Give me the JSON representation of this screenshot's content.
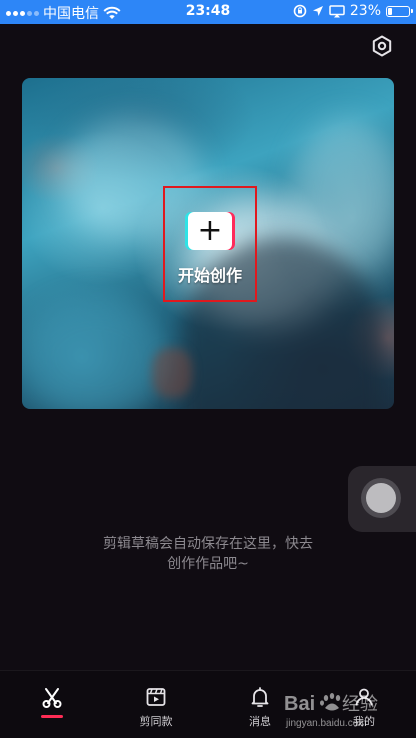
{
  "status_bar": {
    "carrier": "中国电信",
    "time": "23:48",
    "battery_percent": "23%",
    "battery_level": 0.23
  },
  "settings": {
    "icon": "hexagon-settings-icon"
  },
  "create": {
    "label": "开始创作",
    "icon_glyph": "+"
  },
  "hint": {
    "line1": "剪辑草稿会自动保存在这里，快去",
    "line2": "创作作品吧~"
  },
  "nav": {
    "items": [
      {
        "label": "",
        "icon": "scissors-icon",
        "active": true
      },
      {
        "label": "剪同款",
        "icon": "template-clapper-icon",
        "active": false
      },
      {
        "label": "消息",
        "icon": "bell-icon",
        "active": false
      },
      {
        "label": "我的",
        "icon": "profile-icon",
        "active": false
      }
    ]
  },
  "colors": {
    "status_bar": "#2d86f7",
    "accent": "#fe2c55",
    "highlight_border": "#e0191e",
    "background": "#100c12"
  },
  "watermark": {
    "brand": "Bai经验",
    "url": "jingyan.baidu.com"
  }
}
